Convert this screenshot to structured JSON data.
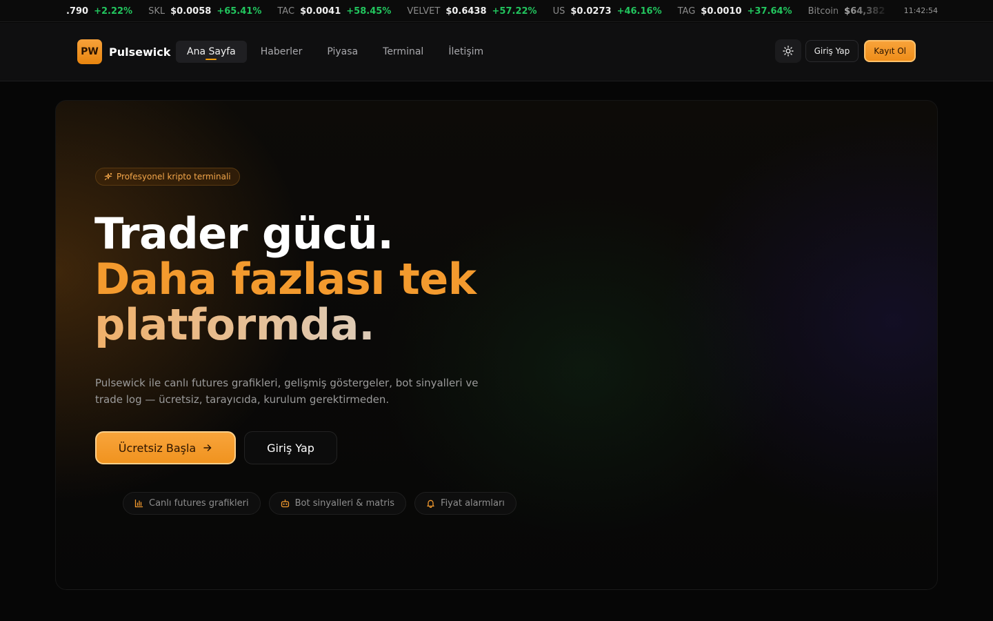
{
  "ticker": {
    "items": [
      {
        "symbol": "",
        "price": ".790",
        "change": "+2.22%"
      },
      {
        "symbol": "SKL",
        "price": "$0.0058",
        "change": "+65.41%"
      },
      {
        "symbol": "TAC",
        "price": "$0.0041",
        "change": "+58.45%"
      },
      {
        "symbol": "VELVET",
        "price": "$0.6438",
        "change": "+57.22%"
      },
      {
        "symbol": "US",
        "price": "$0.0273",
        "change": "+46.16%"
      },
      {
        "symbol": "TAG",
        "price": "$0.0010",
        "change": "+37.64%"
      },
      {
        "symbol": "Bitcoin",
        "price": "$64,382",
        "change": ""
      }
    ],
    "time": "11:42:54"
  },
  "header": {
    "logo_mark": "PW",
    "logo_text": "Pulsewick",
    "nav": [
      "Ana Sayfa",
      "Haberler",
      "Piyasa",
      "Terminal",
      "İletişim"
    ],
    "active_nav": "Ana Sayfa",
    "theme_icon": "sun-icon",
    "login_label": "Giriş Yap",
    "signup_label": "Kayıt Ol"
  },
  "hero": {
    "badge": "Profesyonel kripto terminali",
    "badge_icon": "sparkles-icon",
    "title_line1": "Trader gücü.",
    "title_line2": "Daha fazlası tek",
    "title_line3": "platformda.",
    "description": "Pulsewick ile canlı futures grafikleri, gelişmiş göstergeler, bot sinyalleri ve trade log — ücretsiz, tarayıcıda, kurulum gerektirmeden.",
    "cta_primary": "Ücretsiz Başla",
    "cta_secondary": "Giriş Yap",
    "features": [
      {
        "label": "Canlı futures grafikleri",
        "icon": "bar-chart-icon"
      },
      {
        "label": "Bot sinyalleri & matris",
        "icon": "bot-icon"
      },
      {
        "label": "Fiyat alarmları",
        "icon": "bell-icon"
      }
    ]
  },
  "colors": {
    "accent": "#f39a2e",
    "positive": "#22c55e",
    "background": "#060606"
  }
}
